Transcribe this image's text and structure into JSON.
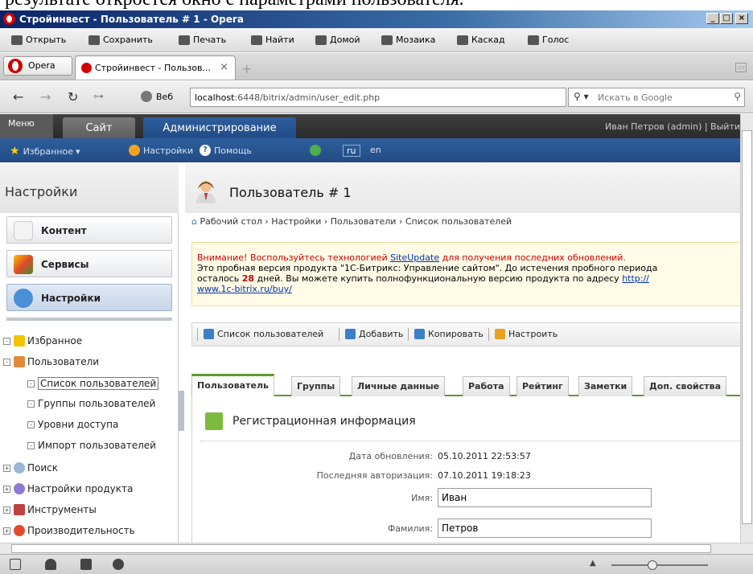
{
  "caption": "результате откроется окно с параметрами пользователя.",
  "window": {
    "title": "Стройинвест - Пользователь # 1 - Opera"
  },
  "menubar": {
    "items": [
      "Открыть",
      "Сохранить",
      "Печать",
      "Найти",
      "Домой",
      "Мозаика",
      "Каскад",
      "Голос"
    ]
  },
  "tabbar": {
    "opera_label": "Opera",
    "tab_title": "Стройинвест - Пользов...",
    "close": "×",
    "new_tab": "+"
  },
  "addressbar": {
    "web_label": "Веб",
    "url_host": "localhost",
    "url_rest": ":6448/bitrix/admin/user_edit.php",
    "search_placeholder": "Искать в Google"
  },
  "bxtop": {
    "menu_label": "Меню",
    "site_tab": "Сайт",
    "admin_tab": "Администрирование",
    "user": "Иван Петров (admin)  |  Выйти"
  },
  "bxpanel": {
    "favorites": "Избранное",
    "settings": "Настройки",
    "help": "Помощь",
    "lang_active": "ru",
    "lang_other": "en"
  },
  "sidebar": {
    "heading": "Настройки",
    "main_buttons": [
      "Контент",
      "Сервисы",
      "Настройки"
    ],
    "tree": [
      {
        "label": "Избранное",
        "pm": "-"
      },
      {
        "label": "Пользователи",
        "pm": "-"
      },
      {
        "label": "Список пользователей",
        "pm": "·"
      },
      {
        "label": "Группы пользователей",
        "pm": "·"
      },
      {
        "label": "Уровни доступа",
        "pm": "·"
      },
      {
        "label": "Импорт пользователей",
        "pm": "·"
      },
      {
        "label": "Поиск",
        "pm": "+"
      },
      {
        "label": "Настройки продукта",
        "pm": "+"
      },
      {
        "label": "Инструменты",
        "pm": "+"
      },
      {
        "label": "Производительность",
        "pm": "+"
      }
    ]
  },
  "page": {
    "title": "Пользователь # 1",
    "breadcrumbs": "Рабочий стол › Настройки › Пользователи › Список пользователей"
  },
  "notice": {
    "line1_a": "Внимание! Воспользуйтесь технологией ",
    "line1_link": "SiteUpdate",
    "line1_b": " для получения последних обновлений.",
    "line2": "Это пробная версия продукта \"1С-Битрикс: Управление сайтом\". До истечения пробного периода",
    "line3_a": "осталось ",
    "days": "28",
    "line3_b": " дней. Вы можете купить полнофункциональную версию продукта по адресу ",
    "link_a": "http://",
    "link_b": "www.1c-bitrix.ru/buy/"
  },
  "toolbar": {
    "items": [
      "Список пользователей",
      "Добавить",
      "Копировать",
      "Настроить"
    ]
  },
  "tabs": [
    "Пользователь",
    "Группы",
    "Личные данные",
    "Работа",
    "Рейтинг",
    "Заметки",
    "Доп. свойства"
  ],
  "form": {
    "section_title": "Регистрационная информация",
    "updated_label": "Дата обновления:",
    "updated_value": "05.10.2011 22:53:57",
    "lastauth_label": "Последняя авторизация:",
    "lastauth_value": "07.10.2011 19:18:23",
    "name_label": "Имя:",
    "name_value": "Иван",
    "lastname_label": "Фамилия:",
    "lastname_value": "Петров"
  }
}
